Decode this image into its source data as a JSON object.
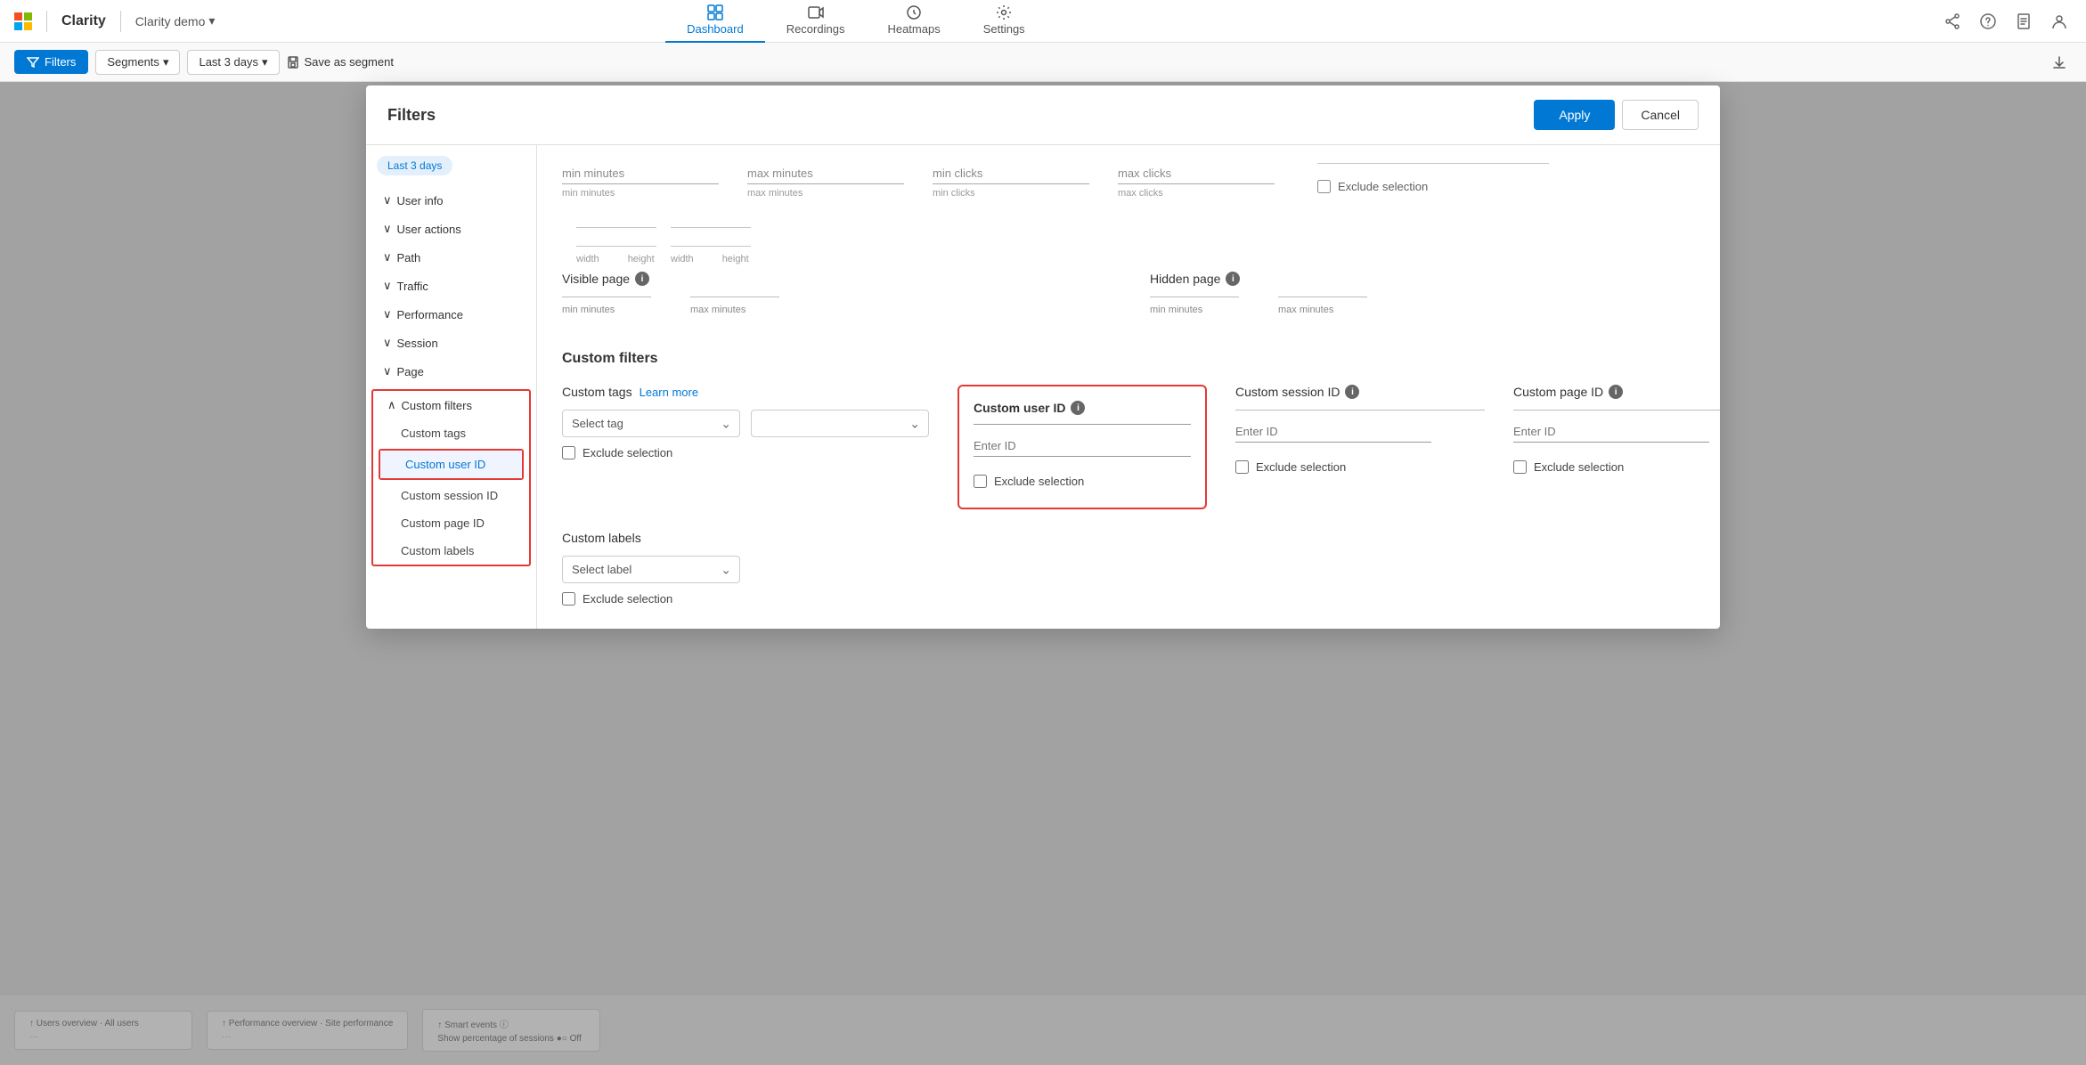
{
  "topbar": {
    "brand": "Clarity",
    "project": "Clarity demo",
    "nav": [
      {
        "id": "dashboard",
        "label": "Dashboard",
        "active": true
      },
      {
        "id": "recordings",
        "label": "Recordings",
        "active": false
      },
      {
        "id": "heatmaps",
        "label": "Heatmaps",
        "active": false
      },
      {
        "id": "settings",
        "label": "Settings",
        "active": false
      }
    ],
    "icons": [
      "share-icon",
      "help-icon",
      "document-icon",
      "user-icon"
    ]
  },
  "subtoolbar": {
    "filters_label": "Filters",
    "segments_label": "Segments",
    "days_label": "Last 3 days",
    "save_label": "Save as segment",
    "download_icon": "download-icon"
  },
  "modal": {
    "title": "Filters",
    "date_chip": "Last 3 days",
    "apply_label": "Apply",
    "cancel_label": "Cancel",
    "sidebar": {
      "items": [
        {
          "id": "user-info",
          "label": "User info",
          "type": "section",
          "expanded": true
        },
        {
          "id": "user-actions",
          "label": "User actions",
          "type": "section",
          "expanded": true
        },
        {
          "id": "path",
          "label": "Path",
          "type": "section",
          "expanded": true
        },
        {
          "id": "traffic",
          "label": "Traffic",
          "type": "section",
          "expanded": true
        },
        {
          "id": "performance",
          "label": "Performance",
          "type": "section",
          "expanded": true
        },
        {
          "id": "session",
          "label": "Session",
          "type": "section",
          "expanded": true
        },
        {
          "id": "page",
          "label": "Page",
          "type": "section",
          "expanded": true
        },
        {
          "id": "custom-filters",
          "label": "Custom filters",
          "type": "section",
          "expanded": true,
          "boxed": true
        },
        {
          "id": "custom-tags",
          "label": "Custom tags",
          "type": "sub",
          "parent": "custom-filters"
        },
        {
          "id": "custom-user-id",
          "label": "Custom user ID",
          "type": "sub",
          "parent": "custom-filters",
          "active": true,
          "boxed": true
        },
        {
          "id": "custom-session-id",
          "label": "Custom session ID",
          "type": "sub",
          "parent": "custom-filters"
        },
        {
          "id": "custom-page-id",
          "label": "Custom page ID",
          "type": "sub",
          "parent": "custom-filters"
        },
        {
          "id": "custom-labels",
          "label": "Custom labels",
          "type": "sub",
          "parent": "custom-filters"
        }
      ]
    },
    "content": {
      "top_fields": {
        "min_minutes": "min minutes",
        "max_minutes": "max minutes",
        "min_clicks": "min clicks",
        "max_clicks": "max clicks"
      },
      "exclude_selection_1": "Exclude selection",
      "width_label": "width",
      "height_label": "height",
      "visible_page": {
        "title": "Visible page",
        "min_minutes": "min minutes",
        "max_minutes": "max minutes"
      },
      "hidden_page": {
        "title": "Hidden page",
        "min_minutes": "min minutes",
        "max_minutes": "max minutes"
      },
      "custom_filters_title": "Custom filters",
      "custom_tags": {
        "title": "Custom tags",
        "learn_more": "Learn more",
        "select_tag_placeholder": "Select tag",
        "exclude_selection": "Exclude selection"
      },
      "custom_user_id": {
        "title": "Custom user ID",
        "enter_id_placeholder": "Enter ID",
        "exclude_selection": "Exclude selection"
      },
      "custom_session_id": {
        "title": "Custom session ID",
        "enter_id_placeholder": "Enter ID",
        "exclude_selection": "Exclude selection"
      },
      "custom_page_id": {
        "title": "Custom page ID",
        "enter_id_placeholder": "Enter ID",
        "exclude_selection": "Exclude selection"
      },
      "custom_labels": {
        "title": "Custom labels",
        "select_label_placeholder": "Select label",
        "exclude_selection": "Exclude selection"
      }
    }
  }
}
